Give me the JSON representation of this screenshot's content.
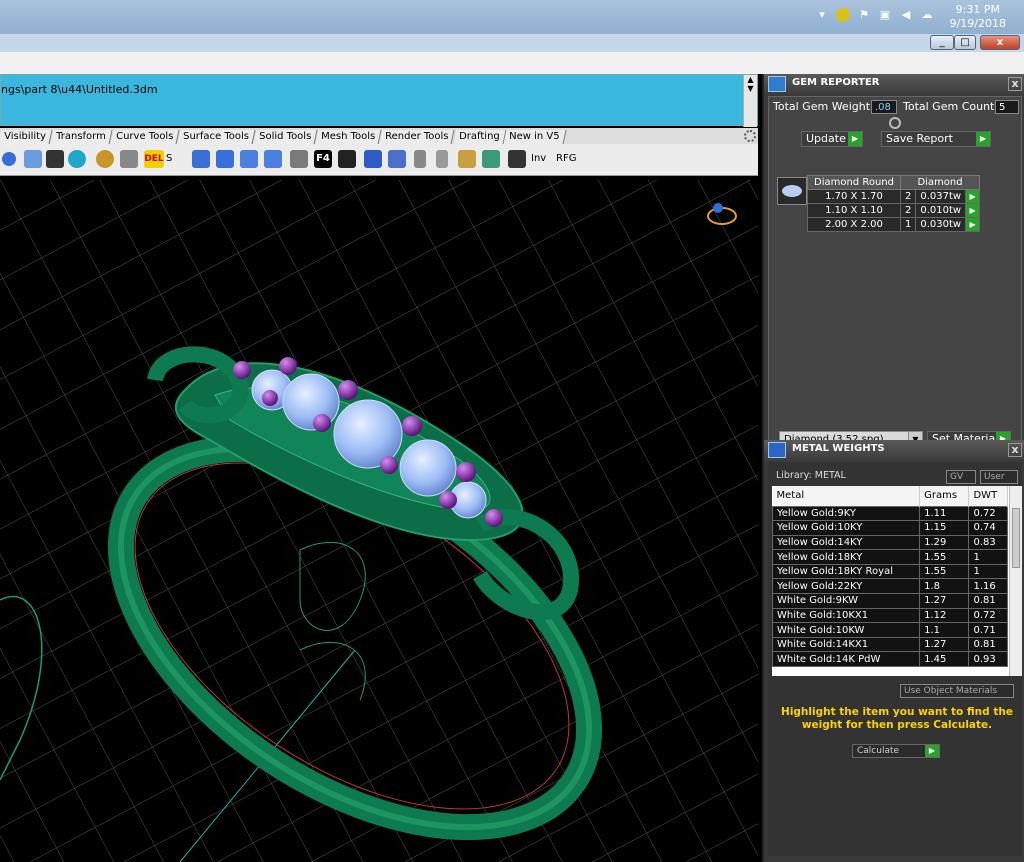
{
  "system": {
    "time": "9:31 PM",
    "date": "9/19/2018",
    "close_glyph": "x",
    "max_glyph": "□",
    "min_glyph": "_"
  },
  "command": {
    "path_text": "ngs\\part 8\\u44\\Untitled.3dm"
  },
  "tabs": [
    "Visibility",
    "Transform",
    "Curve Tools",
    "Surface Tools",
    "Solid Tools",
    "Mesh Tools",
    "Render Tools",
    "Drafting",
    "New in V5"
  ],
  "toolbar": {
    "s_label": "S",
    "del_label": "DEL",
    "f4_label": "F4",
    "inv_label": "Inv",
    "rfg_label": "RFG"
  },
  "gem_reporter": {
    "title": "GEM REPORTER",
    "total_weight_label": "Total Gem Weight",
    "total_weight_value": ".08",
    "total_count_label": "Total Gem Count",
    "total_count_value": "5",
    "update_label": "Update",
    "save_report_label": "Save Report",
    "table_headers": [
      "Diamond Round",
      "Diamond"
    ],
    "rows": [
      {
        "size": "1.70 X 1.70",
        "qty": "2",
        "weight": "0.037tw"
      },
      {
        "size": "1.10 X 1.10",
        "qty": "2",
        "weight": "0.010tw"
      },
      {
        "size": "2.00 X 2.00",
        "qty": "1",
        "weight": "0.030tw"
      }
    ],
    "material_value": "Diamond    (3.52 spg)",
    "set_material_label": "Set Material"
  },
  "metal_weights": {
    "title": "METAL WEIGHTS",
    "library_label": "Library: METAL",
    "gv_label": "GV",
    "user_label": "User",
    "headers": [
      "Metal",
      "Grams",
      "DWT"
    ],
    "rows": [
      {
        "metal": "Yellow Gold:9KY",
        "grams": "1.11",
        "dwt": "0.72"
      },
      {
        "metal": "Yellow Gold:10KY",
        "grams": "1.15",
        "dwt": "0.74"
      },
      {
        "metal": "Yellow Gold:14KY",
        "grams": "1.29",
        "dwt": "0.83"
      },
      {
        "metal": "Yellow Gold:18KY",
        "grams": "1.55",
        "dwt": "1"
      },
      {
        "metal": "Yellow Gold:18KY Royal",
        "grams": "1.55",
        "dwt": "1"
      },
      {
        "metal": "Yellow Gold:22KY",
        "grams": "1.8",
        "dwt": "1.16"
      },
      {
        "metal": "White Gold:9KW",
        "grams": "1.27",
        "dwt": "0.81"
      },
      {
        "metal": "White Gold:10KX1",
        "grams": "1.12",
        "dwt": "0.72"
      },
      {
        "metal": "White Gold:10KW",
        "grams": "1.1",
        "dwt": "0.71"
      },
      {
        "metal": "White Gold:14KX1",
        "grams": "1.27",
        "dwt": "0.81"
      },
      {
        "metal": "White Gold:14K PdW",
        "grams": "1.45",
        "dwt": "0.93"
      }
    ],
    "use_object_materials_label": "Use Object Materials",
    "hint": "Highlight the item you want to find the weight for then press Calculate.",
    "calculate_label": "Calculate"
  },
  "colors": {
    "ring_green": "#0e7a4f",
    "gem_blue": "#9bbcf4",
    "prong_purple": "#7a22a6",
    "command_cyan": "#39b7df",
    "hint_yellow": "#ffd200"
  }
}
